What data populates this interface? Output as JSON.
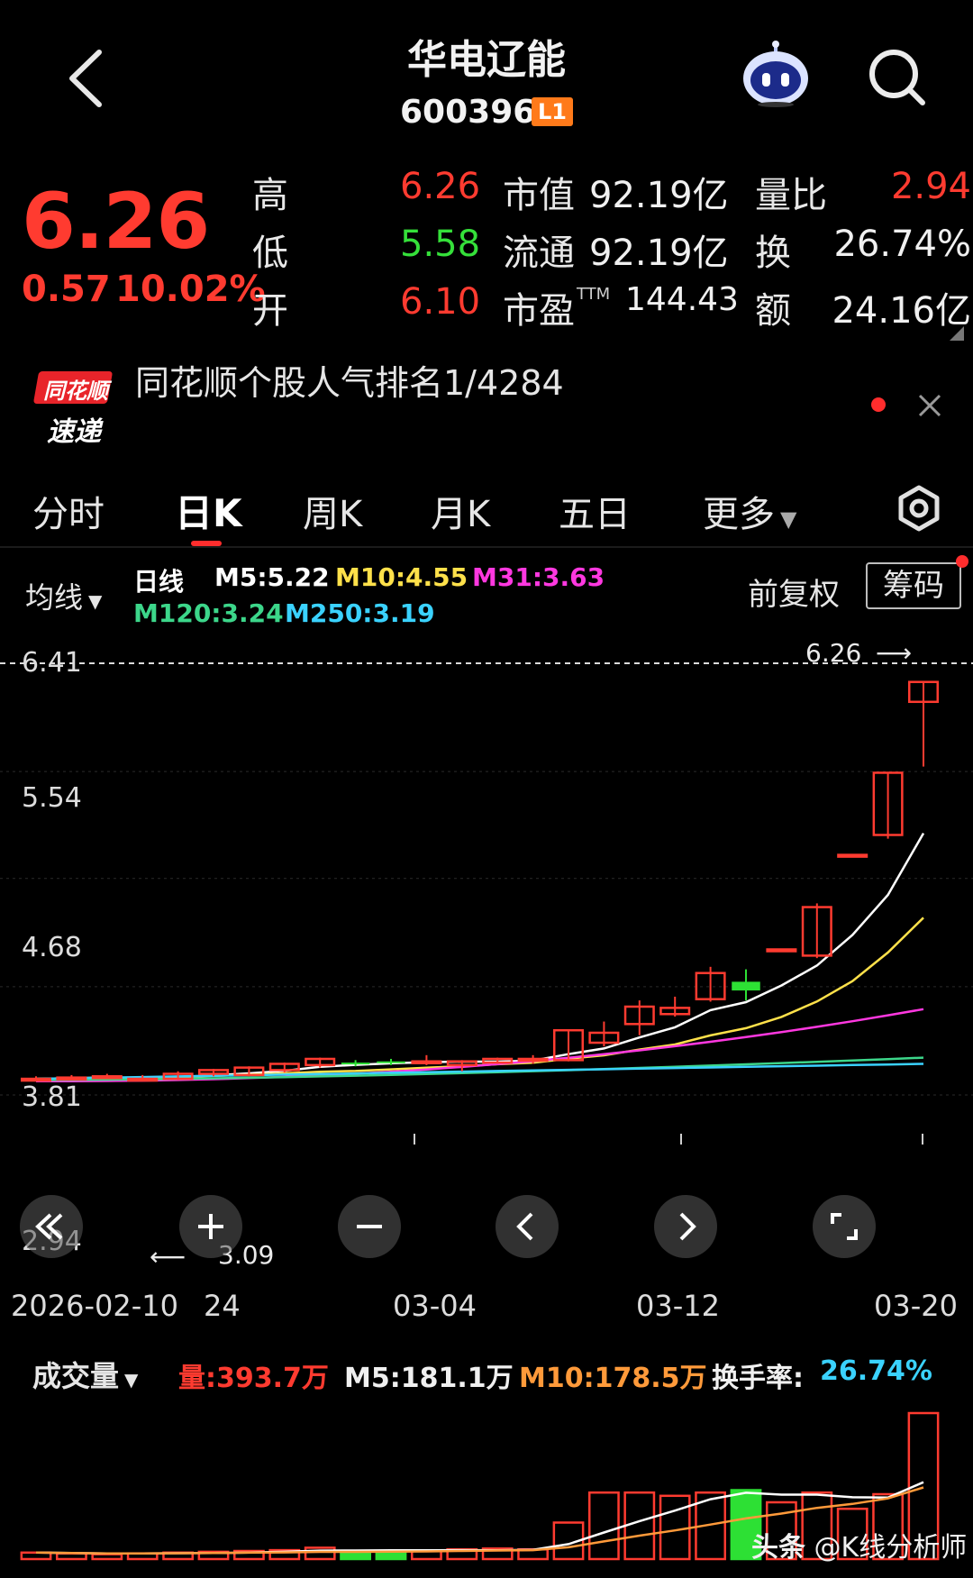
{
  "header": {
    "title": "华电辽能",
    "code": "600396",
    "level_badge": "L1"
  },
  "quote": {
    "price": "6.26",
    "change": "0.57",
    "change_pct": "10.02%",
    "rows": [
      {
        "label": "高",
        "value": "6.26",
        "value_color": "#ff3b30",
        "m_label": "市值",
        "m_value": "92.19亿",
        "r_label": "量比",
        "r_value": "2.94",
        "r_color": "#ff3b30"
      },
      {
        "label": "低",
        "value": "5.58",
        "value_color": "#35e03a",
        "m_label": "流通",
        "m_value": "92.19亿",
        "r_label": "换",
        "r_value": "26.74%",
        "r_color": "#f0f0f0"
      },
      {
        "label": "开",
        "value": "6.10",
        "value_color": "#ff3b30",
        "m_label": "市盈",
        "m_sup": "TTM",
        "m_value": "144.43",
        "r_label": "额",
        "r_value": "24.16亿",
        "r_color": "#f0f0f0"
      }
    ]
  },
  "banner": {
    "logo_line1": "同花顺",
    "logo_line2": "速递",
    "text": "同花顺个股人气排名1/4284"
  },
  "tabs": [
    {
      "label": "分时",
      "active": false
    },
    {
      "label": "日K",
      "active": true
    },
    {
      "label": "周K",
      "active": false
    },
    {
      "label": "月K",
      "active": false
    },
    {
      "label": "五日",
      "active": false
    },
    {
      "label": "更多",
      "active": false
    }
  ],
  "ma_bar": {
    "selector": "均线",
    "period": "日线",
    "m5": "M5:5.22",
    "m10": "M10:4.55",
    "m31": "M31:3.63",
    "m120": "M120:3.24",
    "m250": "M250:3.19",
    "fuquan": "前复权",
    "chouma": "筹码",
    "colors": {
      "m5": "#ffffff",
      "m10": "#ffe14a",
      "m31": "#ff38e0",
      "m120": "#3cd68a",
      "m250": "#3ad2ff"
    }
  },
  "price_axis": {
    "labels": [
      "6.41",
      "5.54",
      "4.68",
      "3.81",
      "2.94"
    ]
  },
  "annotations": {
    "high": "6.26",
    "low": "3.09"
  },
  "date_axis": {
    "labels": [
      "2026-02-10",
      "24",
      "03-04",
      "03-12",
      "03-20"
    ]
  },
  "volume_bar": {
    "selector": "成交量",
    "vol": "量:393.7万",
    "m5": "M5:181.1万",
    "m10": "M10:178.5万",
    "turnover_label": "换手率:",
    "turnover_value": "26.74%"
  },
  "watermark": {
    "platform": "头条",
    "author": "@K线分析师"
  },
  "chart_data": {
    "type": "candlestick",
    "x_range": [
      "2026-02-10",
      "2026-03-20"
    ],
    "ylim": [
      2.94,
      6.41
    ],
    "candles": [
      {
        "open": 3.06,
        "close": 3.07,
        "high": 3.09,
        "low": 3.05
      },
      {
        "open": 3.08,
        "close": 3.08,
        "high": 3.1,
        "low": 3.07
      },
      {
        "open": 3.08,
        "close": 3.09,
        "high": 3.11,
        "low": 3.07
      },
      {
        "open": 3.07,
        "close": 3.07,
        "high": 3.1,
        "low": 3.07
      },
      {
        "open": 3.07,
        "close": 3.11,
        "high": 3.13,
        "low": 3.06
      },
      {
        "open": 3.11,
        "close": 3.14,
        "high": 3.15,
        "low": 3.09
      },
      {
        "open": 3.1,
        "close": 3.16,
        "high": 3.17,
        "low": 3.09
      },
      {
        "open": 3.14,
        "close": 3.19,
        "high": 3.2,
        "low": 3.12
      },
      {
        "open": 3.18,
        "close": 3.23,
        "high": 3.24,
        "low": 3.16
      },
      {
        "open": 3.2,
        "close": 3.19,
        "high": 3.22,
        "low": 3.17
      },
      {
        "open": 3.21,
        "close": 3.2,
        "high": 3.23,
        "low": 3.18
      },
      {
        "open": 3.21,
        "close": 3.21,
        "high": 3.26,
        "low": 3.18
      },
      {
        "open": 3.18,
        "close": 3.21,
        "high": 3.22,
        "low": 3.13
      },
      {
        "open": 3.2,
        "close": 3.23,
        "high": 3.24,
        "low": 3.19
      },
      {
        "open": 3.23,
        "close": 3.23,
        "high": 3.26,
        "low": 3.19
      },
      {
        "open": 3.22,
        "close": 3.46,
        "high": 3.46,
        "low": 3.21
      },
      {
        "open": 3.36,
        "close": 3.44,
        "high": 3.53,
        "low": 3.33
      },
      {
        "open": 3.51,
        "close": 3.65,
        "high": 3.7,
        "low": 3.42
      },
      {
        "open": 3.59,
        "close": 3.64,
        "high": 3.73,
        "low": 3.57
      },
      {
        "open": 3.71,
        "close": 3.92,
        "high": 3.97,
        "low": 3.69
      },
      {
        "open": 3.85,
        "close": 3.78,
        "high": 3.95,
        "low": 3.7
      },
      {
        "open": 4.11,
        "close": 4.11,
        "high": 4.11,
        "low": 4.11
      },
      {
        "open": 4.06,
        "close": 4.45,
        "high": 4.48,
        "low": 4.04
      },
      {
        "open": 4.87,
        "close": 4.87,
        "high": 4.87,
        "low": 4.87
      },
      {
        "open": 5.03,
        "close": 5.53,
        "high": 5.53,
        "low": 5.0
      },
      {
        "open": 6.1,
        "close": 6.26,
        "high": 6.26,
        "low": 5.58
      }
    ],
    "volume": {
      "last": "393.7万",
      "m5": "181.1万",
      "m10": "178.5万"
    }
  }
}
